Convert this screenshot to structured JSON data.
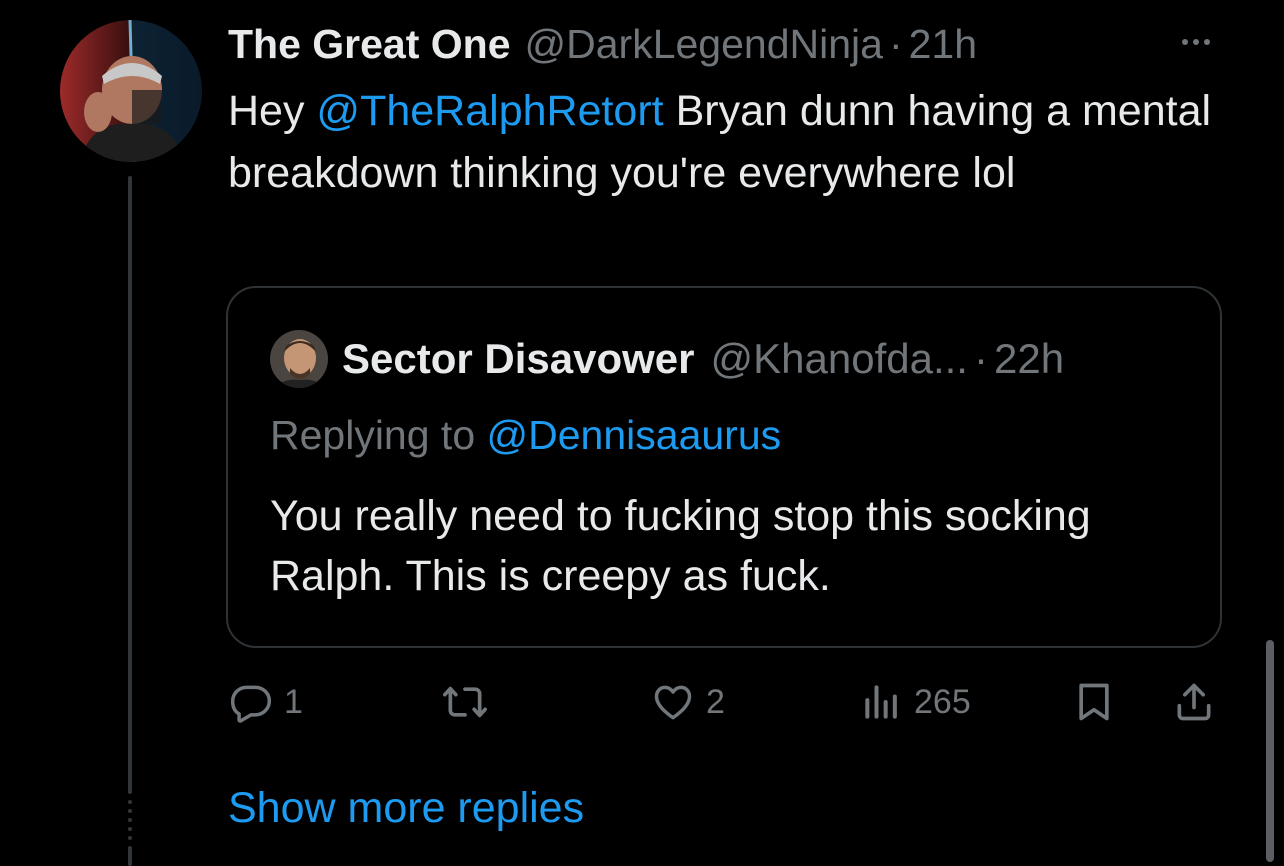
{
  "tweet": {
    "author_name": "The Great One",
    "author_handle": "@DarkLegendNinja",
    "separator": "·",
    "time": "21h",
    "text_prefix": "Hey ",
    "text_mention": "@TheRalphRetort",
    "text_suffix": " Bryan dunn having a mental breakdown thinking you're everywhere lol"
  },
  "quote": {
    "author_name": "Sector Disavower",
    "author_handle": "@Khanofda...",
    "separator": "·",
    "time": "22h",
    "replying_label": "Replying to ",
    "replying_handle": "@Dennisaaurus",
    "text": "You really need to fucking stop this socking Ralph. This is creepy as fuck."
  },
  "actions": {
    "reply_count": "1",
    "retweet_count": "",
    "like_count": "2",
    "views_count": "265"
  },
  "show_more_label": "Show more replies",
  "icons": {
    "reply": "reply-icon",
    "retweet": "retweet-icon",
    "like": "heart-icon",
    "views": "views-icon",
    "bookmark": "bookmark-icon",
    "share": "share-icon",
    "more": "more-icon"
  },
  "colors": {
    "background": "#000000",
    "text": "#e7e9ea",
    "secondary": "#71767b",
    "accent": "#1d9bf0",
    "border": "#2f3336"
  }
}
